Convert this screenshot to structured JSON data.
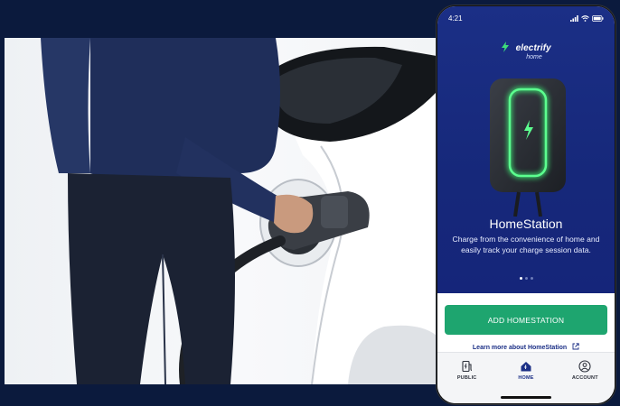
{
  "status_bar": {
    "time": "4:21"
  },
  "brand": {
    "name": "electrify",
    "sub": "home"
  },
  "product": {
    "title": "HomeStation",
    "description": "Charge from the convenience of home and easily track your charge session data."
  },
  "carousel": {
    "pages": 3,
    "active": 0
  },
  "actions": {
    "add_label": "ADD HOMESTATION",
    "learn_label": "Learn more about HomeStation"
  },
  "tabs": [
    {
      "label": "PUBLIC",
      "icon": "charger-icon",
      "active": false
    },
    {
      "label": "HOME",
      "icon": "home-icon",
      "active": true
    },
    {
      "label": "ACCOUNT",
      "icon": "account-icon",
      "active": false
    }
  ],
  "colors": {
    "background": "#0b1a3d",
    "app_blue": "#1b2f86",
    "accent_green": "#1ea56f",
    "glow_green": "#3dff7a"
  }
}
